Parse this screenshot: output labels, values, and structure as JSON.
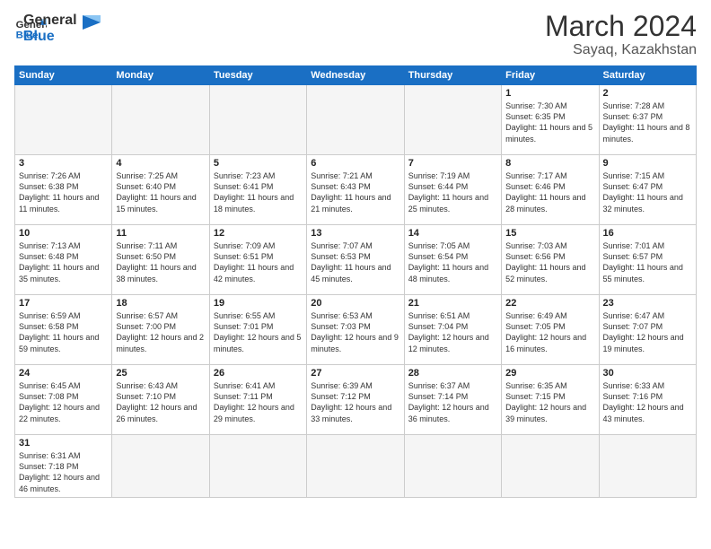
{
  "header": {
    "logo_general": "General",
    "logo_blue": "Blue",
    "month_title": "March 2024",
    "location": "Sayaq, Kazakhstan"
  },
  "weekdays": [
    "Sunday",
    "Monday",
    "Tuesday",
    "Wednesday",
    "Thursday",
    "Friday",
    "Saturday"
  ],
  "weeks": [
    [
      {
        "day": "",
        "info": "",
        "empty": true
      },
      {
        "day": "",
        "info": "",
        "empty": true
      },
      {
        "day": "",
        "info": "",
        "empty": true
      },
      {
        "day": "",
        "info": "",
        "empty": true
      },
      {
        "day": "",
        "info": "",
        "empty": true
      },
      {
        "day": "1",
        "info": "Sunrise: 7:30 AM\nSunset: 6:35 PM\nDaylight: 11 hours\nand 5 minutes."
      },
      {
        "day": "2",
        "info": "Sunrise: 7:28 AM\nSunset: 6:37 PM\nDaylight: 11 hours\nand 8 minutes."
      }
    ],
    [
      {
        "day": "3",
        "info": "Sunrise: 7:26 AM\nSunset: 6:38 PM\nDaylight: 11 hours\nand 11 minutes."
      },
      {
        "day": "4",
        "info": "Sunrise: 7:25 AM\nSunset: 6:40 PM\nDaylight: 11 hours\nand 15 minutes."
      },
      {
        "day": "5",
        "info": "Sunrise: 7:23 AM\nSunset: 6:41 PM\nDaylight: 11 hours\nand 18 minutes."
      },
      {
        "day": "6",
        "info": "Sunrise: 7:21 AM\nSunset: 6:43 PM\nDaylight: 11 hours\nand 21 minutes."
      },
      {
        "day": "7",
        "info": "Sunrise: 7:19 AM\nSunset: 6:44 PM\nDaylight: 11 hours\nand 25 minutes."
      },
      {
        "day": "8",
        "info": "Sunrise: 7:17 AM\nSunset: 6:46 PM\nDaylight: 11 hours\nand 28 minutes."
      },
      {
        "day": "9",
        "info": "Sunrise: 7:15 AM\nSunset: 6:47 PM\nDaylight: 11 hours\nand 32 minutes."
      }
    ],
    [
      {
        "day": "10",
        "info": "Sunrise: 7:13 AM\nSunset: 6:48 PM\nDaylight: 11 hours\nand 35 minutes."
      },
      {
        "day": "11",
        "info": "Sunrise: 7:11 AM\nSunset: 6:50 PM\nDaylight: 11 hours\nand 38 minutes."
      },
      {
        "day": "12",
        "info": "Sunrise: 7:09 AM\nSunset: 6:51 PM\nDaylight: 11 hours\nand 42 minutes."
      },
      {
        "day": "13",
        "info": "Sunrise: 7:07 AM\nSunset: 6:53 PM\nDaylight: 11 hours\nand 45 minutes."
      },
      {
        "day": "14",
        "info": "Sunrise: 7:05 AM\nSunset: 6:54 PM\nDaylight: 11 hours\nand 48 minutes."
      },
      {
        "day": "15",
        "info": "Sunrise: 7:03 AM\nSunset: 6:56 PM\nDaylight: 11 hours\nand 52 minutes."
      },
      {
        "day": "16",
        "info": "Sunrise: 7:01 AM\nSunset: 6:57 PM\nDaylight: 11 hours\nand 55 minutes."
      }
    ],
    [
      {
        "day": "17",
        "info": "Sunrise: 6:59 AM\nSunset: 6:58 PM\nDaylight: 11 hours\nand 59 minutes."
      },
      {
        "day": "18",
        "info": "Sunrise: 6:57 AM\nSunset: 7:00 PM\nDaylight: 12 hours\nand 2 minutes."
      },
      {
        "day": "19",
        "info": "Sunrise: 6:55 AM\nSunset: 7:01 PM\nDaylight: 12 hours\nand 5 minutes."
      },
      {
        "day": "20",
        "info": "Sunrise: 6:53 AM\nSunset: 7:03 PM\nDaylight: 12 hours\nand 9 minutes."
      },
      {
        "day": "21",
        "info": "Sunrise: 6:51 AM\nSunset: 7:04 PM\nDaylight: 12 hours\nand 12 minutes."
      },
      {
        "day": "22",
        "info": "Sunrise: 6:49 AM\nSunset: 7:05 PM\nDaylight: 12 hours\nand 16 minutes."
      },
      {
        "day": "23",
        "info": "Sunrise: 6:47 AM\nSunset: 7:07 PM\nDaylight: 12 hours\nand 19 minutes."
      }
    ],
    [
      {
        "day": "24",
        "info": "Sunrise: 6:45 AM\nSunset: 7:08 PM\nDaylight: 12 hours\nand 22 minutes."
      },
      {
        "day": "25",
        "info": "Sunrise: 6:43 AM\nSunset: 7:10 PM\nDaylight: 12 hours\nand 26 minutes."
      },
      {
        "day": "26",
        "info": "Sunrise: 6:41 AM\nSunset: 7:11 PM\nDaylight: 12 hours\nand 29 minutes."
      },
      {
        "day": "27",
        "info": "Sunrise: 6:39 AM\nSunset: 7:12 PM\nDaylight: 12 hours\nand 33 minutes."
      },
      {
        "day": "28",
        "info": "Sunrise: 6:37 AM\nSunset: 7:14 PM\nDaylight: 12 hours\nand 36 minutes."
      },
      {
        "day": "29",
        "info": "Sunrise: 6:35 AM\nSunset: 7:15 PM\nDaylight: 12 hours\nand 39 minutes."
      },
      {
        "day": "30",
        "info": "Sunrise: 6:33 AM\nSunset: 7:16 PM\nDaylight: 12 hours\nand 43 minutes."
      }
    ],
    [
      {
        "day": "31",
        "info": "Sunrise: 6:31 AM\nSunset: 7:18 PM\nDaylight: 12 hours\nand 46 minutes."
      },
      {
        "day": "",
        "info": "",
        "empty": true
      },
      {
        "day": "",
        "info": "",
        "empty": true
      },
      {
        "day": "",
        "info": "",
        "empty": true
      },
      {
        "day": "",
        "info": "",
        "empty": true
      },
      {
        "day": "",
        "info": "",
        "empty": true
      },
      {
        "day": "",
        "info": "",
        "empty": true
      }
    ]
  ]
}
